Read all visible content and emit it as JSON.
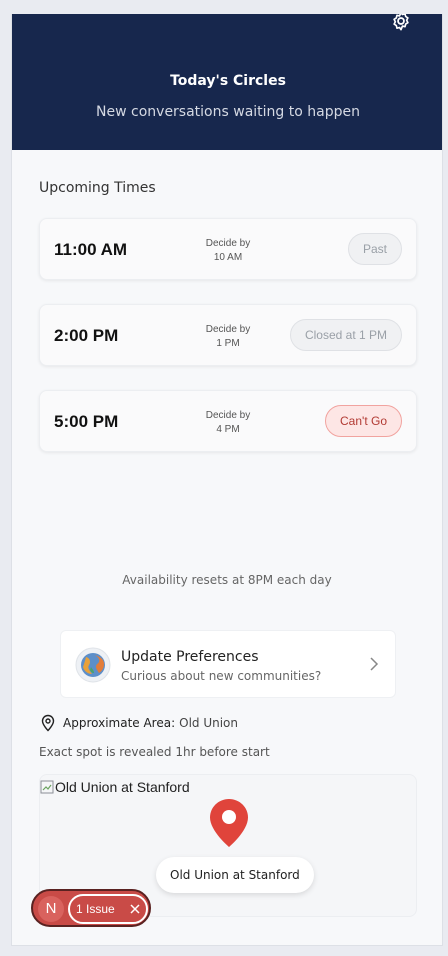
{
  "header": {
    "title": "Today's Circles",
    "subtitle": "New conversations waiting to happen"
  },
  "upcoming": {
    "heading": "Upcoming Times",
    "slots": [
      {
        "time": "11:00 AM",
        "decide_label": "Decide by",
        "decide_time": "10 AM",
        "status": "Past"
      },
      {
        "time": "2:00 PM",
        "decide_label": "Decide by",
        "decide_time": "1 PM",
        "status": "Closed at 1 PM"
      },
      {
        "time": "5:00 PM",
        "decide_label": "Decide by",
        "decide_time": "4 PM",
        "status": "Can't Go"
      }
    ]
  },
  "reset_note": "Availability resets at 8PM each day",
  "preferences": {
    "title": "Update Preferences",
    "subtitle": "Curious about new communities?"
  },
  "location": {
    "label": "Approximate Area:",
    "value": "Old Union",
    "note": "Exact spot is revealed 1hr before start"
  },
  "map": {
    "image_alt": "Old Union at Stanford",
    "pin_label": "Old Union at Stanford"
  },
  "dev_overlay": {
    "logo_letter": "N",
    "issues_label": "1 Issue"
  },
  "colors": {
    "header_bg": "#17274d",
    "cant_go_bg": "#fde6e5",
    "cant_go_text": "#b23a33",
    "pin": "#e0443b"
  },
  "icons": [
    "gear-icon",
    "globe-icon",
    "chevron-right-icon",
    "location-pin-icon",
    "broken-image-icon",
    "map-marker-icon",
    "close-icon"
  ]
}
